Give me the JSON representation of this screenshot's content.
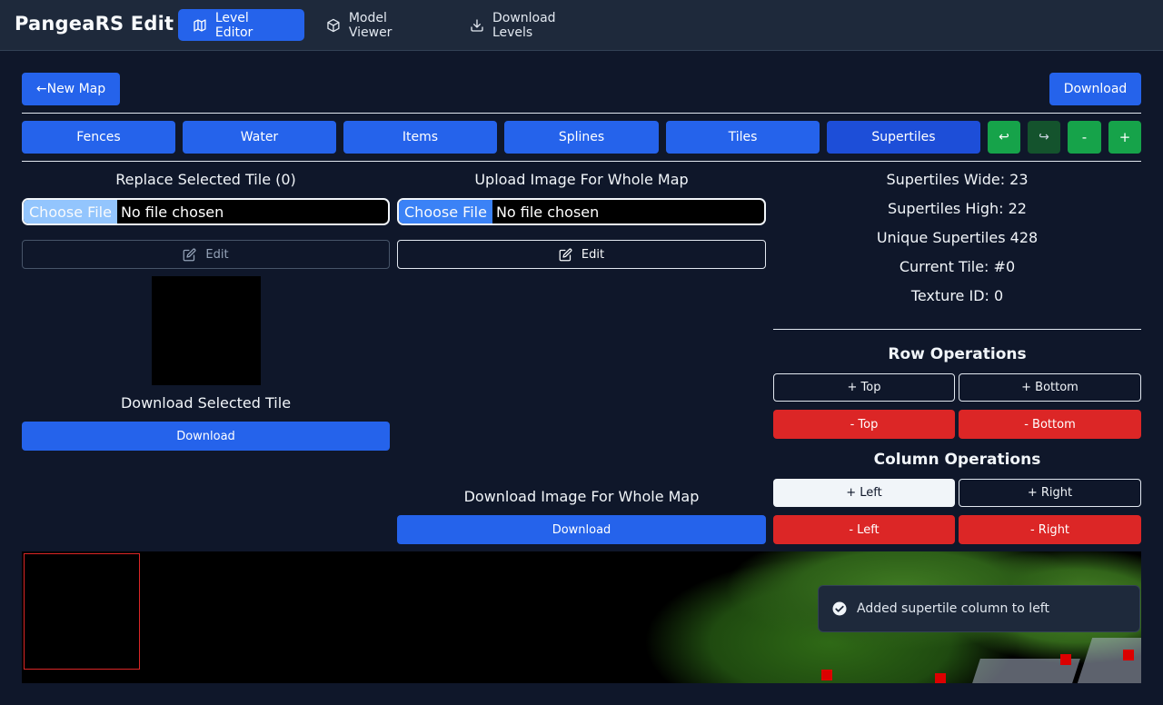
{
  "app": {
    "title": "PangeaRS Edit",
    "nav": [
      {
        "label": "Level Editor",
        "icon": "map-icon",
        "active": true
      },
      {
        "label": "Model Viewer",
        "icon": "cube-icon",
        "active": false
      },
      {
        "label": "Download Levels",
        "icon": "download-icon",
        "active": false
      }
    ]
  },
  "toolbar": {
    "new_map": "←New Map",
    "download": "Download"
  },
  "tabs": [
    "Fences",
    "Water",
    "Items",
    "Splines",
    "Tiles",
    "Supertiles"
  ],
  "selected_tab": "Supertiles",
  "history": {
    "undo": "↩",
    "redo": "↪",
    "minus": "-",
    "plus": "+"
  },
  "tile_panel": {
    "replace_heading": "Replace Selected Tile (0)",
    "choose_file": "Choose File",
    "no_file": "No file chosen",
    "edit": "Edit",
    "download_heading": "Download Selected Tile",
    "download": "Download"
  },
  "map_panel": {
    "upload_heading": "Upload Image For Whole Map",
    "choose_file": "Choose File",
    "no_file": "No file chosen",
    "edit": "Edit",
    "download_heading": "Download Image For Whole Map",
    "download": "Download"
  },
  "stats": {
    "wide": "Supertiles Wide: 23",
    "high": "Supertiles High: 22",
    "unique": "Unique Supertiles 428",
    "current": "Current Tile: #0",
    "texture": "Texture ID: 0"
  },
  "row_ops": {
    "heading": "Row Operations",
    "add_top": "+ Top",
    "add_bottom": "+ Bottom",
    "remove_top": "- Top",
    "remove_bottom": "- Bottom"
  },
  "col_ops": {
    "heading": "Column Operations",
    "add_left": "+ Left",
    "add_right": "+ Right",
    "remove_left": "- Left",
    "remove_right": "- Right"
  },
  "toast": {
    "message": "Added supertile column to left",
    "icon": "check-circle-icon"
  },
  "colors": {
    "accent": "#2563eb",
    "danger": "#dc2626",
    "success": "#16a34a",
    "background": "#0f172a"
  }
}
